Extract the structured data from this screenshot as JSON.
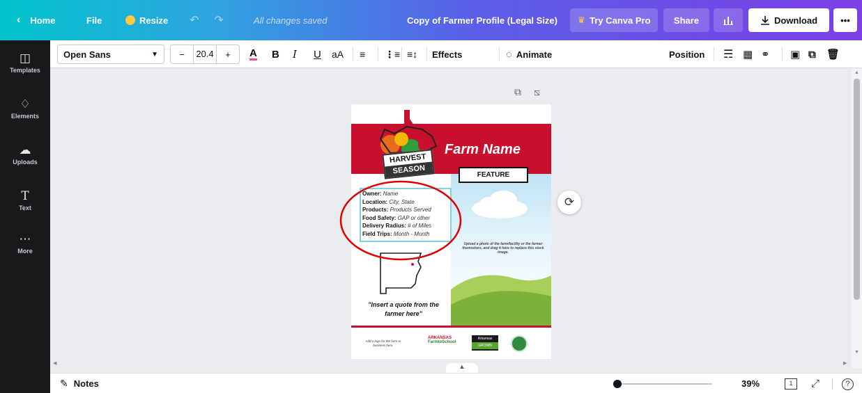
{
  "topbar": {
    "home_label": "Home",
    "file_label": "File",
    "resize_label": "Resize",
    "save_status": "All changes saved",
    "document_title": "Copy of Farmer Profile (Legal Size)",
    "try_pro_label": "Try Canva Pro",
    "share_label": "Share",
    "download_label": "Download",
    "more_label": "•••"
  },
  "sidebar": {
    "items": [
      {
        "label": "Templates",
        "icon": "templates-icon"
      },
      {
        "label": "Elements",
        "icon": "elements-icon"
      },
      {
        "label": "Uploads",
        "icon": "uploads-icon"
      },
      {
        "label": "Text",
        "icon": "text-icon"
      },
      {
        "label": "More",
        "icon": "more-icon"
      }
    ]
  },
  "toolbar": {
    "font_family": "Open Sans",
    "font_size": "20.4",
    "minus_label": "−",
    "plus_label": "+",
    "case_label": "aA",
    "effects_label": "Effects",
    "animate_label": "Animate",
    "position_label": "Position"
  },
  "page": {
    "farm_name": "Farm Name",
    "logo_text_1": "HARVEST",
    "logo_text_2": "SEASON",
    "feature_label": "FEATURE",
    "info_rows": [
      {
        "key": "Owner:",
        "value": "Name"
      },
      {
        "key": "Location:",
        "value": "City, State"
      },
      {
        "key": "Products:",
        "value": "Products Served"
      },
      {
        "key": "Food Safety:",
        "value": "GAP or other"
      },
      {
        "key": "Delivery Radius:",
        "value": "# of Miles"
      },
      {
        "key": "Field Trips:",
        "value": "Month - Month"
      }
    ],
    "upload_hint": "Upload a photo of the farm/facility or the farmer themselves, and drag it here to replace this stock image.",
    "quote": "\"Insert a quote from the farmer here\"",
    "footer_logo_hint": "Add a logo for the farm or business here.",
    "ark_logo_line1": "ARKANSAS",
    "ark_logo_line2": "FarmtoSchool",
    "ark_grown_line1": "Arkansas",
    "ark_grown_line2": "GROWN"
  },
  "bottombar": {
    "notes_label": "Notes",
    "zoom_label": "39%",
    "zoom_level": 0.39,
    "page_count": "1"
  },
  "colors": {
    "accent_red": "#c8102e",
    "sidebar_bg": "#18191b",
    "annotation": "#e00000"
  }
}
